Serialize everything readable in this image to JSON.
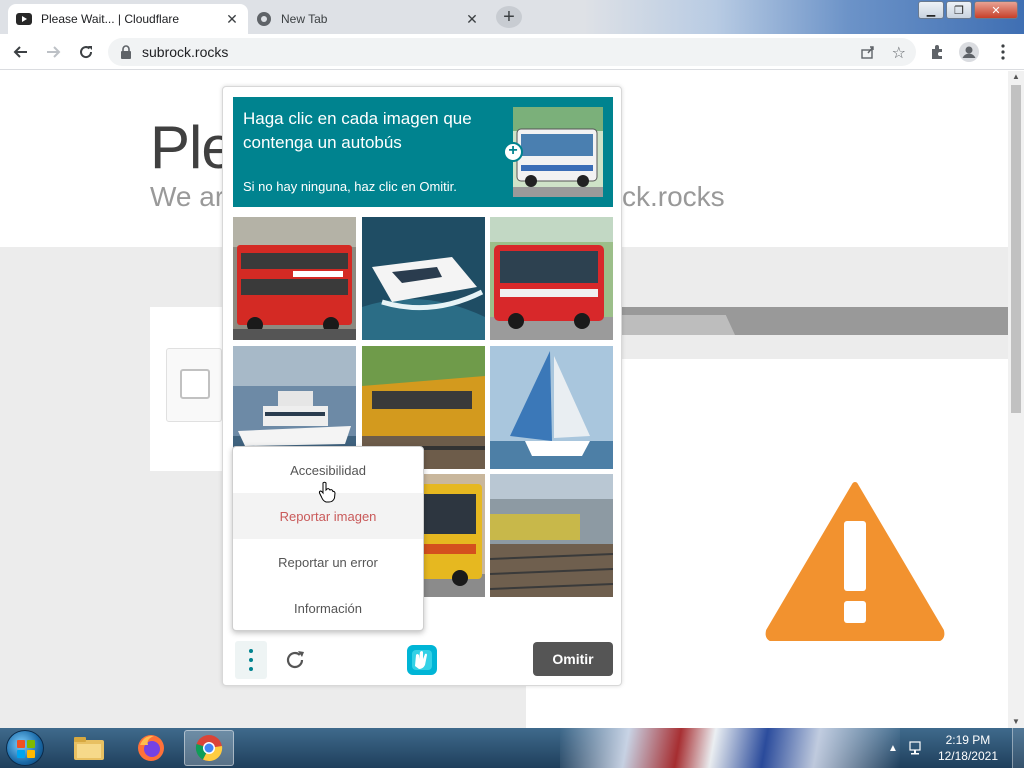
{
  "browser": {
    "tabs": [
      {
        "title": "Please Wait... | Cloudflare",
        "active": true,
        "favicon": "youtube-icon"
      },
      {
        "title": "New Tab",
        "active": false,
        "favicon": "chrome-icon"
      }
    ],
    "new_tab_label": "+",
    "url": "subrock.rocks"
  },
  "cloudflare": {
    "heading": "Ple",
    "sub_left": "We ar",
    "sub_right": "ck.rocks"
  },
  "captcha": {
    "prompt": "Haga clic en cada imagen que contenga un autobús",
    "hint": "Si no hay ninguna, haz clic en Omitir.",
    "sample_icon": "bus-icon",
    "tiles": [
      {
        "subject": "red double-decker bus"
      },
      {
        "subject": "speedboat"
      },
      {
        "subject": "red city bus"
      },
      {
        "subject": "white yacht"
      },
      {
        "subject": "yellow train"
      },
      {
        "subject": "sailboat"
      },
      {
        "subject": "hidden by menu"
      },
      {
        "subject": "yellow bus"
      },
      {
        "subject": "train on tracks"
      }
    ],
    "skip_label": "Omitir",
    "menu": {
      "items": [
        {
          "label": "Accesibilidad",
          "hover": false
        },
        {
          "label": "Reportar imagen",
          "hover": true
        },
        {
          "label": "Reportar un error",
          "hover": false
        },
        {
          "label": "Información",
          "hover": false
        }
      ]
    }
  },
  "taskbar": {
    "apps": [
      "file-explorer-icon",
      "firefox-icon",
      "chrome-icon"
    ],
    "time": "2:19 PM",
    "date": "12/18/2021"
  },
  "colors": {
    "captcha_header": "#00838f",
    "skip_button": "#555555",
    "warning": "#f2922f",
    "menu_hover_text": "#c95a5a"
  }
}
